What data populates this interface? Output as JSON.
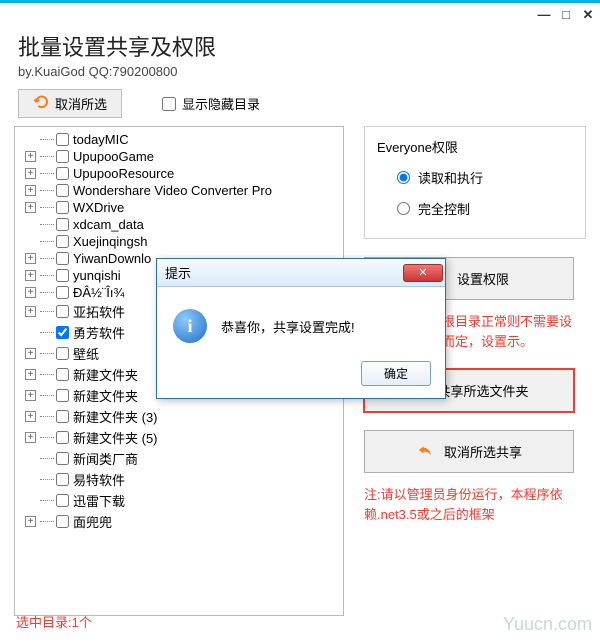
{
  "window": {
    "title": "批量设置共享及权限",
    "subtitle": "by.KuaiGod  QQ:790200800"
  },
  "toolbar": {
    "deselect": "取消所选",
    "show_hidden": "显示隐藏目录",
    "show_hidden_checked": false
  },
  "tree": {
    "items": [
      {
        "exp": "",
        "chk": false,
        "label": "todayMIC"
      },
      {
        "exp": "+",
        "chk": false,
        "label": "UpupooGame"
      },
      {
        "exp": "+",
        "chk": false,
        "label": "UpupooResource"
      },
      {
        "exp": "+",
        "chk": false,
        "label": "Wondershare Video Converter Pro"
      },
      {
        "exp": "+",
        "chk": false,
        "label": "WXDrive"
      },
      {
        "exp": "",
        "chk": false,
        "label": "xdcam_data"
      },
      {
        "exp": "",
        "chk": false,
        "label": "Xuejinqingsh"
      },
      {
        "exp": "+",
        "chk": false,
        "label": "YiwanDownlo"
      },
      {
        "exp": "+",
        "chk": false,
        "label": "yunqishi"
      },
      {
        "exp": "+",
        "chk": false,
        "label": "ÐÂ½¨Îı¾"
      },
      {
        "exp": "+",
        "chk": false,
        "label": "亚拓软件"
      },
      {
        "exp": "",
        "chk": true,
        "label": "勇芳软件"
      },
      {
        "exp": "+",
        "chk": false,
        "label": "壁纸"
      },
      {
        "exp": "+",
        "chk": false,
        "label": "新建文件夹"
      },
      {
        "exp": "+",
        "chk": false,
        "label": "新建文件夹"
      },
      {
        "exp": "+",
        "chk": false,
        "label": "新建文件夹 (3)"
      },
      {
        "exp": "+",
        "chk": false,
        "label": "新建文件夹 (5)"
      },
      {
        "exp": "",
        "chk": false,
        "label": "新闻类厂商"
      },
      {
        "exp": "",
        "chk": false,
        "label": "易特软件"
      },
      {
        "exp": "",
        "chk": false,
        "label": "迅雷下载"
      },
      {
        "exp": "+",
        "chk": false,
        "label": "面兜兜"
      }
    ]
  },
  "perm": {
    "group_title": "Everyone权限",
    "read_exec": "读取和执行",
    "full_ctrl": "完全控制",
    "selected": "read_exec",
    "set_btn": "设置权限",
    "tip": "置所选目录的根目录正常则不需要设置，文件数量而定，设置示。"
  },
  "share": {
    "share_btn": "共享所选文件夹",
    "unshare_btn": "取消所选共享"
  },
  "footer_note": "注:请以管理员身份运行，本程序依赖.net3.5或之后的框架",
  "status": "选中目录:1个",
  "watermark": "Yuucn.com",
  "dialog": {
    "title": "提示",
    "message": "恭喜你，共享设置完成!",
    "ok": "确定"
  }
}
